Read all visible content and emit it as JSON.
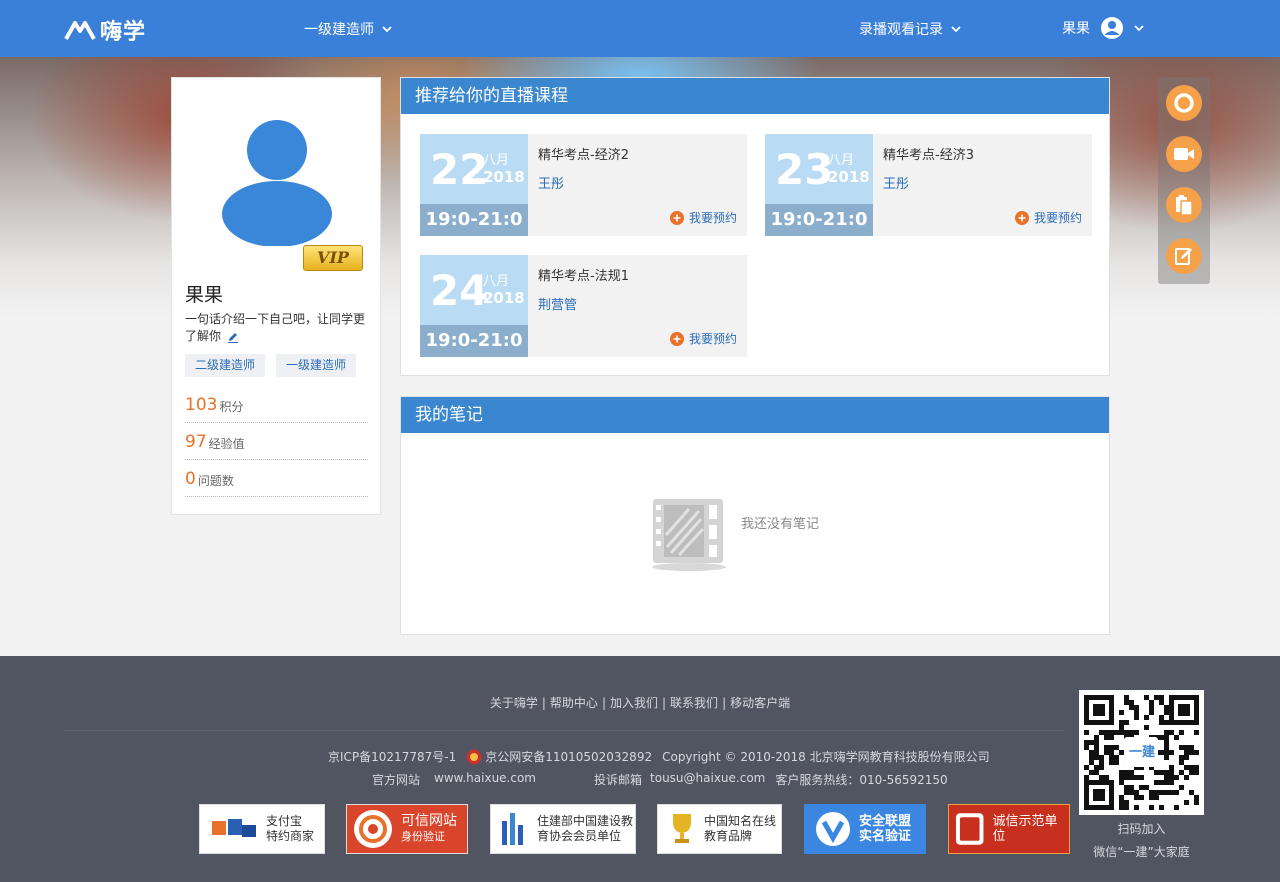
{
  "header": {
    "logo_text": "嗨学",
    "exam_select": "一级建造师",
    "history_label": "录播观看记录",
    "user_name": "果果"
  },
  "profile": {
    "vip_label": "VIP",
    "name": "果果",
    "bio": "一句话介绍一下自己吧，让同学更了解你",
    "tags": [
      "二级建造师",
      "一级建造师"
    ],
    "stats": [
      {
        "value": "103",
        "label": "积分"
      },
      {
        "value": "97",
        "label": "经验值"
      },
      {
        "value": "0",
        "label": "问题数"
      }
    ]
  },
  "live_panel": {
    "title": "推荐给你的直播课程",
    "courses": [
      {
        "day": "22",
        "month": "八月",
        "year": "2018",
        "time": "19:0-21:0",
        "title": "精华考点-经济2",
        "teacher": "王彤",
        "action": "我要预约"
      },
      {
        "day": "23",
        "month": "八月",
        "year": "2018",
        "time": "19:0-21:0",
        "title": "精华考点-经济3",
        "teacher": "王彤",
        "action": "我要预约"
      },
      {
        "day": "24",
        "month": "八月",
        "year": "2018",
        "time": "19:0-21:0",
        "title": "精华考点-法规1",
        "teacher": "荆营管",
        "action": "我要预约"
      }
    ]
  },
  "notes_panel": {
    "title": "我的笔记",
    "empty_text": "我还没有笔记"
  },
  "footer": {
    "links": [
      "关于嗨学",
      "帮助中心",
      "加入我们",
      "联系我们",
      "移动客户端"
    ],
    "icp": "京ICP备10217787号-1",
    "police": "京公网安备11010502032892",
    "copyright": "Copyright © 2010-2018 北京嗨学网教育科技股份有限公司",
    "site_label": "官方网站",
    "site_url": "www.haixue.com",
    "complaint_label": "投诉邮箱",
    "complaint_email": "tousu@haixue.com",
    "hotline": "客户服务热线：010-56592150",
    "badges": [
      {
        "line1": "支付宝",
        "line2": "特约商家"
      },
      {
        "line1": "可信网站",
        "line2": "身份验证"
      },
      {
        "line1": "住建部中国建设教",
        "line2": "育协会会员单位"
      },
      {
        "line1": "中国知名在线",
        "line2": "教育品牌"
      },
      {
        "line1": "安全联盟",
        "line2": "实名验证"
      },
      {
        "line1": "诚信示范单位",
        "line2": ""
      }
    ],
    "qr_center": "一建",
    "qr_caption1": "扫码加入",
    "qr_caption2": "微信“一建”大家庭"
  },
  "colors": {
    "brand_blue": "#3a7fd8",
    "panel_head": "#3a86cf",
    "accent_orange": "#e8722a",
    "tool_orange": "#f4a14a",
    "footer_bg": "#515562"
  }
}
